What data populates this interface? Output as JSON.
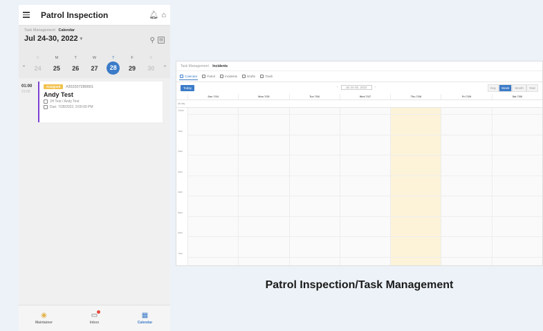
{
  "mobile": {
    "title": "Patrol Inspection",
    "tabs": {
      "inactive": "Task Management",
      "active": "Calendar"
    },
    "date_range": "Jul 24-30, 2022",
    "week": [
      {
        "dow": "S",
        "num": "24",
        "state": "muted"
      },
      {
        "dow": "M",
        "num": "25",
        "state": "normal"
      },
      {
        "dow": "T",
        "num": "26",
        "state": "normal"
      },
      {
        "dow": "W",
        "num": "27",
        "state": "normal"
      },
      {
        "dow": "T",
        "num": "28",
        "state": "selected"
      },
      {
        "dow": "F",
        "num": "29",
        "state": "normal"
      },
      {
        "dow": "S",
        "num": "30",
        "state": "muted"
      }
    ],
    "task": {
      "time": "01:00",
      "time_end": "23:00",
      "badge": "Assigned",
      "id": "#202207280001",
      "name": "Andy Test",
      "assignees": "JH Test / Andy Test",
      "due": "Due: 7/28/2022, 9:00:00 PM"
    },
    "nav": [
      {
        "label": "Maintainer"
      },
      {
        "label": "Inbox"
      },
      {
        "label": "Calendar"
      }
    ]
  },
  "desktop": {
    "breadcrumb": {
      "inactive": "Task Management",
      "active": "Incidents"
    },
    "tabs": [
      "Calendar",
      "Patrol",
      "Incidents",
      "Drafts",
      "Trash"
    ],
    "today_label": "Today",
    "range_label": "Jul 24-30, 2022",
    "views": [
      "Day",
      "Week",
      "Month",
      "Year"
    ],
    "days": [
      "Sun 7/24",
      "Mon 7/25",
      "Tue 7/26",
      "Wed 7/27",
      "Thu 7/28",
      "Fri 7/29",
      "Sat 7/30"
    ],
    "all_day_label": "all-day",
    "hours": [
      "12am",
      "1am",
      "2am",
      "3am",
      "4am",
      "5am",
      "6am",
      "7am"
    ]
  },
  "caption": "Patrol Inspection/Task Management",
  "colors": {
    "accent": "#3b7bc8",
    "today_highlight": "#fdf3d9",
    "card_border": "#7b3fcf",
    "badge": "#f2c14e"
  }
}
